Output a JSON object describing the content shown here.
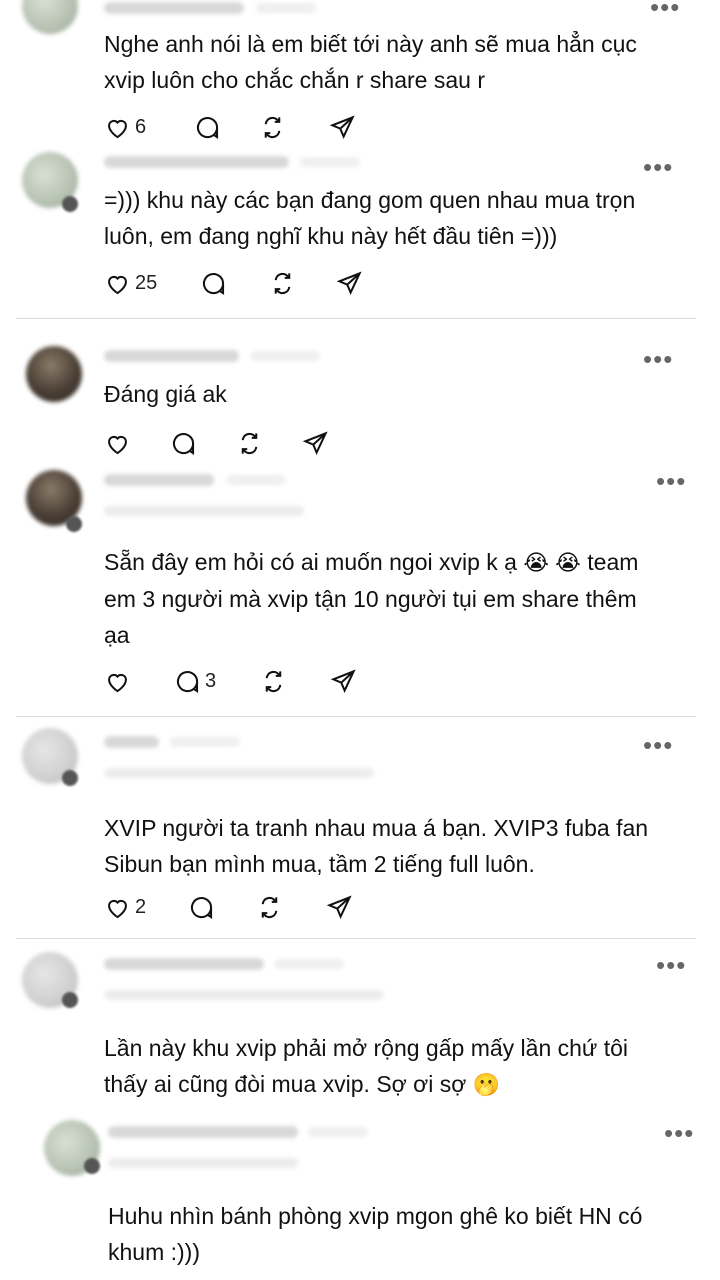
{
  "comments": [
    {
      "text": "Nghe anh nói là em biết tới này anh sẽ mua hẳn cục\nxvip luôn cho chắc chắn r share sau r",
      "likes": "6",
      "replies": "",
      "more_icon": "more-options-icon"
    },
    {
      "text": "=))) khu này các bạn đang gom quen nhau mua trọn\nluôn, em đang nghĩ khu này hết đầu tiên =)))",
      "likes": "25",
      "replies": ""
    },
    {
      "text": "Đáng giá ak",
      "likes": "",
      "replies": ""
    },
    {
      "text_before": "Sẵn đây em hỏi có ai muốn ngoi xvip k ạ ",
      "emoji": "😭 😭",
      "text_after": " team\nem 3 người mà xvip tận 10 người tụi em share thêm\nạa",
      "likes": "",
      "replies": "3"
    },
    {
      "text": "XVIP người ta tranh nhau mua á bạn. XVIP3 fuba fan\nSibun bạn mình mua, tầm 2 tiếng full luôn.",
      "likes": "2",
      "replies": ""
    },
    {
      "text_before": "Lần này khu xvip phải mở rộng gấp mấy lần chứ tôi\nthấy ai cũng đòi mua xvip. Sợ ơi sợ ",
      "emoji": "🫢",
      "likes": "",
      "replies": ""
    },
    {
      "text": "Huhu nhìn bánh phòng xvip mgon ghê ko biết HN có\nkhum :)))",
      "likes": "",
      "replies": ""
    }
  ],
  "more_label": "•••"
}
